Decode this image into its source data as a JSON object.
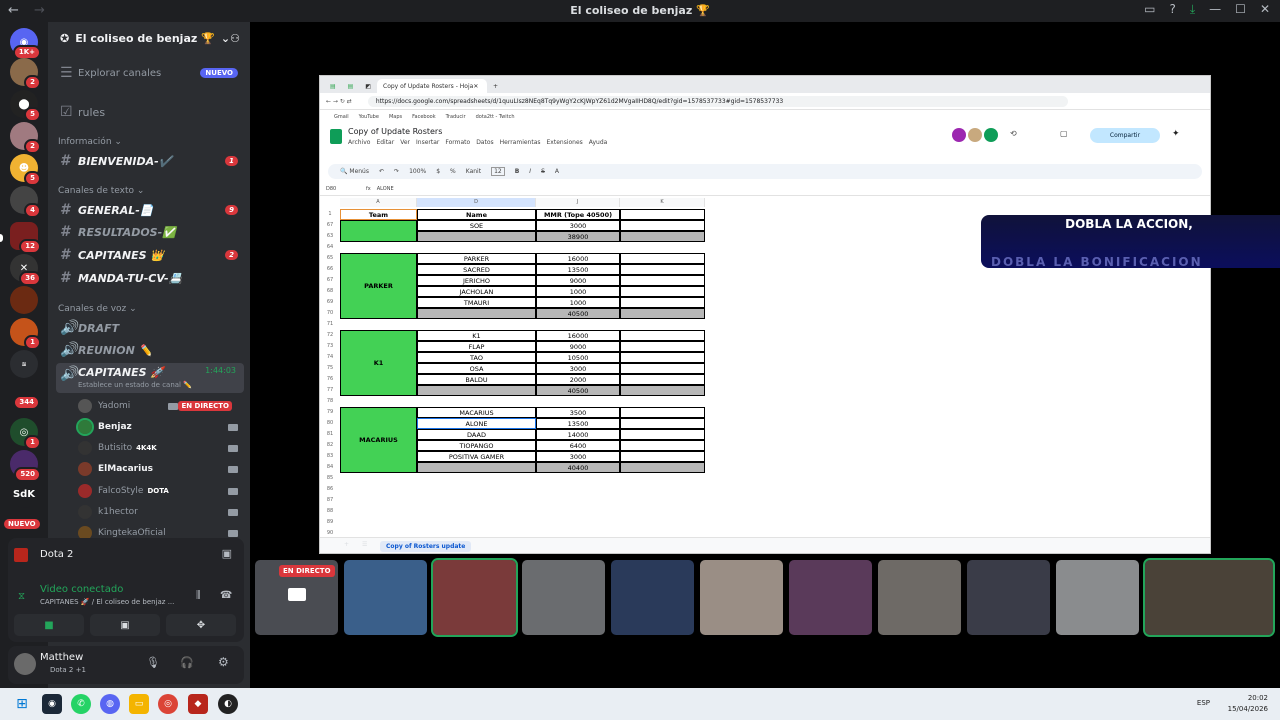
{
  "window": {
    "title": "El coliseo de benjaz 🏆"
  },
  "server": {
    "name": "El coliseo de benjaz 🏆",
    "explore": "Explorar canales",
    "explore_badge": "NUEVO",
    "rules": "rules"
  },
  "categories": {
    "info": "Información",
    "text": "Canales de texto",
    "voice": "Canales de voz"
  },
  "channels": [
    {
      "name": "BIENVENIDA-✔️",
      "badge": "1"
    },
    {
      "name": "GENERAL-📄",
      "badge": "9"
    },
    {
      "name": "RESULTADOS-✅",
      "badge": ""
    },
    {
      "name": "CAPITANES 👑",
      "badge": "2"
    },
    {
      "name": "MANDA-TU-CV-📇",
      "badge": ""
    }
  ],
  "voice_channels": {
    "draft": "DRAFT",
    "reunion": "REUNION ✏️",
    "capitanes": "CAPITANES 🚀",
    "timer": "1:44:03",
    "status": "Establece un estado de canal ✏️"
  },
  "voice_users": [
    {
      "name": "Yadomi",
      "tag": "EN DIRECTO",
      "game": ""
    },
    {
      "name": "Benjaz",
      "tag": "",
      "game": ""
    },
    {
      "name": "Butisito",
      "tag": "",
      "game": "4K4K"
    },
    {
      "name": "ElMacarius",
      "tag": "",
      "game": ""
    },
    {
      "name": "FalcoStyle",
      "tag": "",
      "game": "DOTA"
    },
    {
      "name": "k1hector",
      "tag": "",
      "game": ""
    },
    {
      "name": "KingtekaOficial",
      "tag": "",
      "game": ""
    }
  ],
  "guild_badges": {
    "top": "1K+",
    "b1": "2",
    "b2": "5",
    "b3": "2",
    "b4": "5",
    "b5": "4",
    "b6": "12",
    "b7": "36",
    "b8": "1",
    "b9": "344",
    "b10": "1",
    "b11": "520",
    "sdk": "SdK",
    "new": "NUEVO"
  },
  "voice_panel": {
    "activity": "Dota 2",
    "status": "Video conectado",
    "channel": "CAPITANES 🚀 / El coliseo de benjaz ..."
  },
  "user": {
    "name": "Matthew",
    "sub": "Dota 2 +1"
  },
  "browser": {
    "tab_title": "Copy of Update Rosters - Hoja",
    "url": "https://docs.google.com/spreadsheets/d/1quuLIsz8NEq8Tq9yWgY2cKJWpYZ61d2MVgaIIHD8Q/edit?gid=1578537733#gid=1578537733",
    "bookmarks": [
      "Gmail",
      "YouTube",
      "Maps",
      "Facebook",
      "Traducir",
      "dota2tt - Twitch"
    ]
  },
  "sheet": {
    "title": "Copy of Update Rosters",
    "menu": [
      "Archivo",
      "Editar",
      "Ver",
      "Insertar",
      "Formato",
      "Datos",
      "Herramientas",
      "Extensiones",
      "Ayuda"
    ],
    "share": "Compartir",
    "toolbar": {
      "menus": "Menús",
      "zoom": "100%",
      "currency": "$",
      "pct": "%",
      "font": "Kanit",
      "size": "12"
    },
    "cellref": "D80",
    "formula": "ALONE",
    "col_headers": [
      "A",
      "D",
      "J",
      "K"
    ],
    "headers": [
      "Team",
      "Name",
      "MMR (Tope 40500)"
    ],
    "tab": "Copy of Rosters update",
    "rows": [
      {
        "r": "1",
        "team": "",
        "name": "",
        "mmr": ""
      },
      {
        "r": "67",
        "name": "SOE",
        "mmr": "3000"
      },
      {
        "r": "63",
        "name": "",
        "mmr": "38900",
        "total": true
      },
      {
        "r": "64",
        "name": "",
        "mmr": ""
      },
      {
        "r": "65",
        "name": "PARKER",
        "mmr": "16000"
      },
      {
        "r": "66",
        "name": "SACRED",
        "mmr": "13500"
      },
      {
        "r": "67",
        "name": "JERICHO",
        "mmr": "9000"
      },
      {
        "r": "68",
        "name": "JACHOLAN",
        "mmr": "1000"
      },
      {
        "r": "69",
        "name": "TMAURI",
        "mmr": "1000"
      },
      {
        "r": "70",
        "name": "",
        "mmr": "40500",
        "total": true
      },
      {
        "r": "71",
        "name": "",
        "mmr": ""
      },
      {
        "r": "72",
        "name": "K1",
        "mmr": "16000"
      },
      {
        "r": "73",
        "name": "FLAP",
        "mmr": "9000"
      },
      {
        "r": "74",
        "name": "TAO",
        "mmr": "10500"
      },
      {
        "r": "75",
        "name": "OSA",
        "mmr": "3000"
      },
      {
        "r": "76",
        "name": "BALDU",
        "mmr": "2000"
      },
      {
        "r": "77",
        "name": "",
        "mmr": "40500",
        "total": true
      },
      {
        "r": "78",
        "name": "",
        "mmr": ""
      },
      {
        "r": "79",
        "name": "MACARIUS",
        "mmr": "3500"
      },
      {
        "r": "80",
        "name": "ALONE",
        "mmr": "13500"
      },
      {
        "r": "81",
        "name": "DAAD",
        "mmr": "14000"
      },
      {
        "r": "82",
        "name": "TIOPANGO",
        "mmr": "6400"
      },
      {
        "r": "83",
        "name": "POSITIVA GAMER",
        "mmr": "3000"
      },
      {
        "r": "84",
        "name": "",
        "mmr": "40400",
        "total": true
      },
      {
        "r": "85"
      },
      {
        "r": "86"
      },
      {
        "r": "87"
      },
      {
        "r": "88"
      },
      {
        "r": "89"
      },
      {
        "r": "90"
      }
    ],
    "teams": [
      "PARKER",
      "K1",
      "MACARIUS"
    ]
  },
  "overlay": {
    "line1": "DOBLA LA ACCION,",
    "line2": "DOBLA LA BONIFICACION"
  },
  "stream": {
    "live": "EN DIRECTO"
  },
  "taskbar": {
    "lang": "ESP",
    "time": "20:02",
    "date": "15/04/2026"
  }
}
